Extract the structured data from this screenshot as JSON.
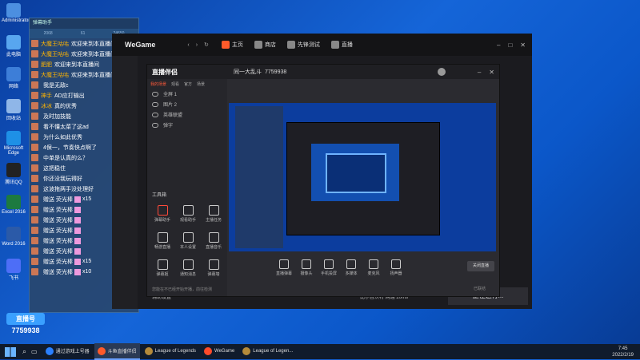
{
  "desktop_icons": [
    {
      "label": "Administrator",
      "color": "#4c8fe0"
    },
    {
      "label": "此电脑",
      "color": "#58a6ef"
    },
    {
      "label": "网络",
      "color": "#3d7ed8"
    },
    {
      "label": "回收站",
      "color": "#8fb6e8"
    },
    {
      "label": "Microsoft Edge",
      "color": "#1e90e6"
    },
    {
      "label": "腾讯QQ",
      "color": "#222222"
    },
    {
      "label": "Excel 2016",
      "color": "#1d7a3f"
    },
    {
      "label": "Word 2016",
      "color": "#2b5aa8"
    },
    {
      "label": "飞书",
      "color": "#4d6ef7"
    }
  ],
  "chat": {
    "title": "弹幕助手",
    "tabs": [
      "2068",
      "61",
      "24650"
    ],
    "messages": [
      {
        "name": "大魔王咕咕",
        "text": "欢迎来到本直播间"
      },
      {
        "name": "大魔王咕咕",
        "text": "欢迎来到本直播间"
      },
      {
        "name": "肥肥",
        "text": "欢迎来到本直播间"
      },
      {
        "name": "大魔王咕咕",
        "text": "欢迎来到本直播间"
      },
      {
        "name": "",
        "text": "我是无敌c"
      },
      {
        "name": "神手",
        "text": "AD应打输出"
      },
      {
        "name": "冰冰",
        "text": "真的优秀"
      },
      {
        "name": "",
        "text": "及时加技能"
      },
      {
        "name": "",
        "text": "看不懂太菜了这ad"
      },
      {
        "name": "",
        "text": "为什么如此优秀"
      },
      {
        "name": "",
        "text": "4保一，节奏快点啊了"
      },
      {
        "name": "",
        "text": "中单是认真的么？"
      },
      {
        "name": "",
        "text": "这把稳住"
      },
      {
        "name": "",
        "text": "你还没我玩得好"
      },
      {
        "name": "",
        "text": "这波拖两手没处理好"
      },
      {
        "name": "",
        "text": "赠送 荧光棒",
        "gift": "x15"
      },
      {
        "name": "",
        "text": "赠送 荧光棒",
        "gift": ""
      },
      {
        "name": "",
        "text": "赠送 荧光棒",
        "gift": ""
      },
      {
        "name": "",
        "text": "赠送 荧光棒",
        "gift": ""
      },
      {
        "name": "",
        "text": "赠送 荧光棒",
        "gift": ""
      },
      {
        "name": "",
        "text": "赠送 荧光棒",
        "gift": ""
      },
      {
        "name": "",
        "text": "赠送 荧光棒",
        "gift": "x15"
      },
      {
        "name": "",
        "text": "赠送 荧光棒",
        "gift": "x10"
      }
    ]
  },
  "wegame": {
    "logo": "WeGame",
    "nav": [
      {
        "label": "主页",
        "color": "#ff5a2a"
      },
      {
        "label": "商店",
        "color": "#888"
      },
      {
        "label": "先锋测试",
        "color": "#888"
      },
      {
        "label": "直播",
        "color": "#888"
      }
    ],
    "bottom_left": "辅助设置",
    "bottom_mid": "比尔吉沃特 网通 20ms",
    "bottom_right": "正在运行..."
  },
  "zhibo": {
    "logo": "直播伴侣",
    "title": "同一大乱斗",
    "room_id": "7759938",
    "tabs": [
      "我的场景",
      "观看",
      "官方",
      "场景"
    ],
    "scenes": [
      "全屏 1",
      "图片 2",
      "英雄联盟",
      "弹字"
    ],
    "tools_title": "工具箱",
    "tools": [
      {
        "label": "弹幕助手",
        "color": "#ff4a3a"
      },
      {
        "label": "观看助手",
        "color": "#ccc"
      },
      {
        "label": "主播任务",
        "color": "#ccc"
      },
      {
        "label": "畅游直播",
        "color": "#ccc"
      },
      {
        "label": "本人设置",
        "color": "#ccc"
      },
      {
        "label": "直播音乐",
        "color": "#ccc"
      },
      {
        "label": "弹幕姬",
        "color": "#ccc"
      },
      {
        "label": "通知消息",
        "color": "#ccc"
      },
      {
        "label": "弹幕墙",
        "color": "#ccc"
      }
    ],
    "controls": [
      "直播弹幕",
      "摄像头",
      "手机投屏",
      "多媒体",
      "麦克风",
      "扬声器"
    ],
    "status": "已联结",
    "end_button": "关闭直播",
    "footer_note": "您能在不已经开始开播，前往检测"
  },
  "taskbar": {
    "items": [
      {
        "label": "通过游戏上号器",
        "color": "#2a80ff",
        "active": false
      },
      {
        "label": "斗鱼直播伴侣",
        "color": "#ff5a2a",
        "active": true
      },
      {
        "label": "League of Legends",
        "color": "#b48a3a",
        "active": false
      },
      {
        "label": "WeGame",
        "color": "#ff4a2a",
        "active": false
      },
      {
        "label": "League of Legen...",
        "color": "#b48a3a",
        "active": false
      }
    ],
    "time": "7:45",
    "date": "2022/2/19"
  },
  "stream_badge": {
    "title": "直播号",
    "number": "7759938"
  }
}
